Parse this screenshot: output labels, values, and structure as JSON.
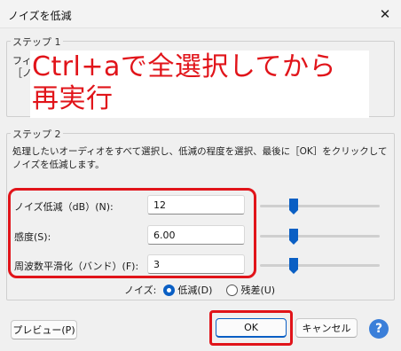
{
  "window": {
    "title": "ノイズを低減",
    "close_glyph": "✕"
  },
  "step1": {
    "label": "ステップ 1",
    "line1": "フィル",
    "line2": "［ノ"
  },
  "overlay": {
    "line1": "Ctrl+aで全選択してから",
    "line2": "再実行",
    "color": "#e1141a"
  },
  "step2": {
    "label": "ステップ 2",
    "description_line1": "処理したいオーディオをすべて選択し、低減の程度を選択、最後に［OK］をクリックして",
    "description_line2": "ノイズを低減します。",
    "params": [
      {
        "label": "ノイズ低減（dB）(N):",
        "value": "12",
        "slider": 0.3
      },
      {
        "label": "感度(S):",
        "value": "6.00",
        "slider": 0.3
      },
      {
        "label": "周波数平滑化（バンド）(F):",
        "value": "3",
        "slider": 0.3
      }
    ],
    "noise": {
      "label": "ノイズ:",
      "option_reduce": "低減(D)",
      "option_residue": "残差(U)",
      "selected": "option_reduce"
    }
  },
  "buttons": {
    "preview": "プレビュー(P)",
    "ok": "OK",
    "cancel": "キャンセル",
    "help": "?"
  },
  "colors": {
    "accent": "#0a5fc4",
    "highlight": "#e1141a"
  }
}
